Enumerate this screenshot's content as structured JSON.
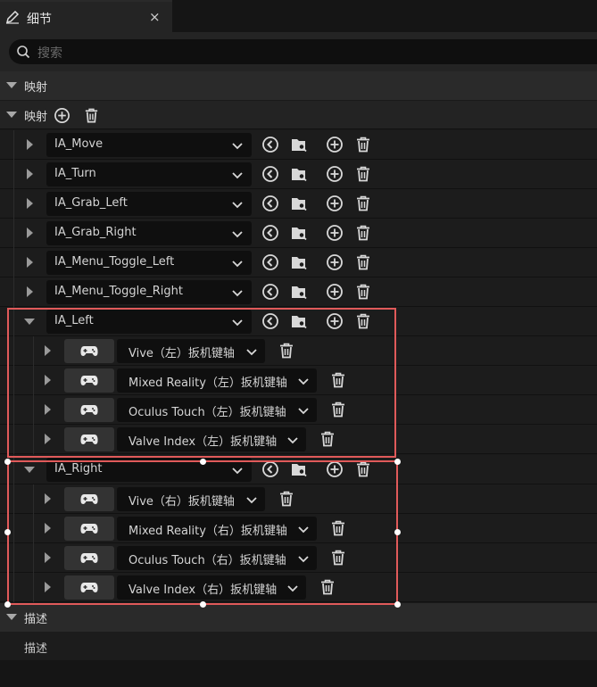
{
  "tab": {
    "title": "细节",
    "close": "×"
  },
  "search": {
    "placeholder": "搜索"
  },
  "categories": {
    "mapping": "映射",
    "description": "描述"
  },
  "mapping_header": {
    "label": "映射"
  },
  "actions": [
    {
      "name": "IA_Move",
      "expanded": false
    },
    {
      "name": "IA_Turn",
      "expanded": false
    },
    {
      "name": "IA_Grab_Left",
      "expanded": false
    },
    {
      "name": "IA_Grab_Right",
      "expanded": false
    },
    {
      "name": "IA_Menu_Toggle_Left",
      "expanded": false
    },
    {
      "name": "IA_Menu_Toggle_Right",
      "expanded": false
    },
    {
      "name": "IA_Left",
      "expanded": true
    },
    {
      "name": "IA_Right",
      "expanded": true
    }
  ],
  "left_bindings": [
    "Vive（左）扳机键轴",
    "Mixed Reality（左）扳机键轴",
    "Oculus Touch（左）扳机键轴",
    "Valve Index（左）扳机键轴"
  ],
  "right_bindings": [
    "Vive（右）扳机键轴",
    "Mixed Reality（右）扳机键轴",
    "Oculus Touch（右）扳机键轴",
    "Valve Index（右）扳机键轴"
  ],
  "description_row": {
    "label": "描述"
  },
  "colors": {
    "highlight": "#e05a5a",
    "panel": "#1c1c1c",
    "field": "#0f0f0f"
  }
}
